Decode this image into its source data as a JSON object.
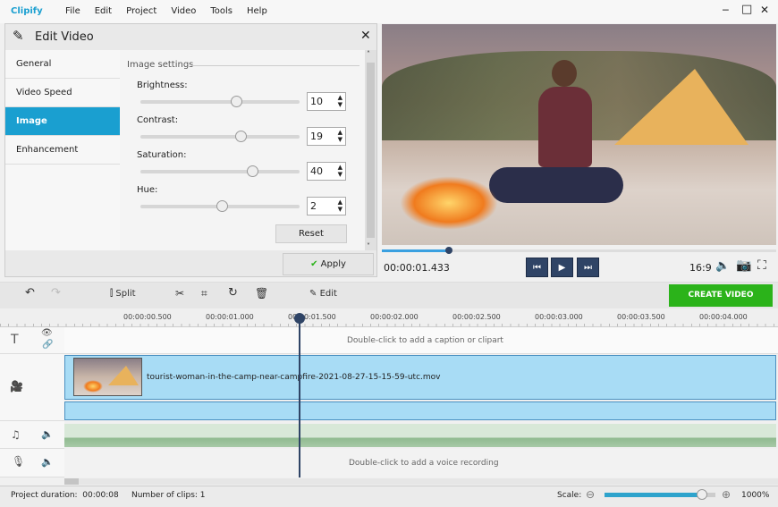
{
  "app": {
    "name": "Clipify",
    "menu": [
      "File",
      "Edit",
      "Project",
      "Video",
      "Tools",
      "Help"
    ]
  },
  "window_controls": {
    "minimize": "─",
    "maximize": "□",
    "close": "✕"
  },
  "panel": {
    "title": "Edit Video",
    "nav": [
      "General",
      "Video Speed",
      "Image",
      "Enhancement"
    ],
    "selected": "Image",
    "section": "Image settings",
    "sliders": [
      {
        "label": "Brightness:",
        "value": "10",
        "pos": 0.6
      },
      {
        "label": "Contrast:",
        "value": "19",
        "pos": 0.63
      },
      {
        "label": "Saturation:",
        "value": "40",
        "pos": 0.7
      },
      {
        "label": "Hue:",
        "value": "2",
        "pos": 0.51
      }
    ],
    "reset": "Reset",
    "apply": "Apply"
  },
  "player": {
    "timecode": "00:00:01.433",
    "progress": 0.17,
    "aspect": "16:9"
  },
  "toolbar": {
    "split": "Split",
    "edit": "Edit",
    "create": "CREATE VIDEO"
  },
  "ruler": [
    "00:00:00.500",
    "00:00:01.000",
    "00:00:01.500",
    "00:00:02.000",
    "00:00:02.500",
    "00:00:03.000",
    "00:00:03.500",
    "00:00:04.000"
  ],
  "tracks": {
    "caption_hint": "Double-click to add a caption or clipart",
    "clip_name": "tourist-woman-in-the-camp-near-campfire-2021-08-27-15-15-59-utc.mov",
    "voice_hint": "Double-click to add a voice recording"
  },
  "status": {
    "duration": "Project duration:  00:00:08",
    "clips": "Number of clips: 1",
    "scale_label": "Scale:",
    "scale_value": "1000%",
    "scale_level": 0.88
  },
  "colors": {
    "accent": "#1a9fd0",
    "create": "#2bb31a",
    "player_btn": "#2f4466"
  }
}
